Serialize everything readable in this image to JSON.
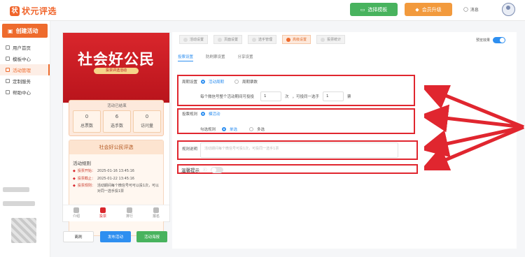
{
  "topbar": {
    "logo_text": "状元评选",
    "template_btn": "选择模板",
    "vip_btn": "会员升级",
    "msg_label": "消息"
  },
  "sidebar": {
    "create_btn": "创建活动",
    "items": [
      {
        "label": "用户首页"
      },
      {
        "label": "模板中心"
      },
      {
        "label": "活动管理"
      },
      {
        "label": "定制服务"
      },
      {
        "label": "帮助中心"
      }
    ]
  },
  "preview": {
    "title": "社会好公民",
    "subtitle": "投票评选活动",
    "status": "活动已结束",
    "stats": [
      {
        "value": "0",
        "label": "总票数"
      },
      {
        "value": "6",
        "label": "选手数"
      },
      {
        "value": "0",
        "label": "访问量"
      }
    ],
    "card_title": "社会好公民评选",
    "rules_head": "活动规则",
    "rules": [
      {
        "key": "投票开始：",
        "value": "2025-01-16 13:45:16"
      },
      {
        "key": "投票截止：",
        "value": "2025-01-22 13:45:16"
      },
      {
        "key": "投票规则：",
        "value": "活动期间每个微信号可可以投1次，可以对同一选手投1票"
      }
    ],
    "nav": [
      {
        "label": "介绍"
      },
      {
        "label": "投票"
      },
      {
        "label": "排行"
      },
      {
        "label": "报名"
      }
    ]
  },
  "actions": {
    "prev": "离刷",
    "publish": "发布活动",
    "preview": "活动海报"
  },
  "settings": {
    "steps": [
      {
        "label": "活动设置"
      },
      {
        "label": "页面设置"
      },
      {
        "label": "选手管理"
      },
      {
        "label": "高级设置"
      },
      {
        "label": "投票统计"
      }
    ],
    "preview_toggle_label": "预览效果",
    "subtabs": [
      {
        "label": "投票设置"
      },
      {
        "label": "防刷票设置"
      },
      {
        "label": "分享设置"
      }
    ],
    "cycle": {
      "label": "周期设置",
      "opt_a": "活动周期",
      "opt_b": "周期票数",
      "line": "每个微信号整个活动期间可投投",
      "count1": "1",
      "unit1": "次",
      "mid": "，可投同一选手",
      "count2": "1",
      "unit2": "票"
    },
    "rule": {
      "label": "投票规则",
      "opt": "模活动",
      "sub_label": "勾选规则",
      "single": "单选",
      "multi": "多选"
    },
    "desc": {
      "label": "规则说明",
      "placeholder": "活动期间每个微信号可投1次，可投同一选手1票"
    },
    "tip": {
      "label": "温馨提示"
    }
  }
}
